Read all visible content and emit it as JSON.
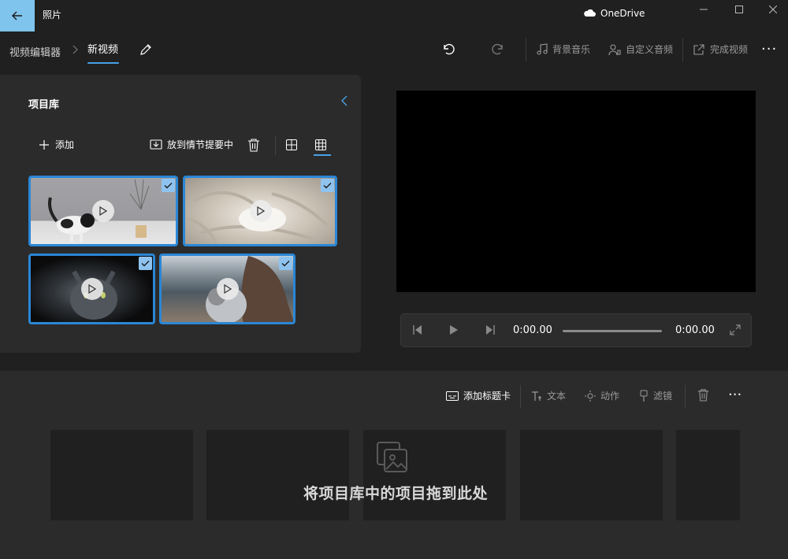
{
  "titlebar": {
    "app_title": "照片",
    "onedrive_label": "OneDrive",
    "back_icon": "arrow-left-icon",
    "accent": "#7fc4ec"
  },
  "toolbar": {
    "breadcrumb_root": "视频编辑器",
    "breadcrumb_current": "新视频",
    "background_music": "背景音乐",
    "custom_audio": "自定义音频",
    "finish_video": "完成视频",
    "more": "···"
  },
  "library": {
    "title": "项目库",
    "add_label": "添加",
    "storyboard_label": "放到情节提要中",
    "thumbnails": [
      {
        "name": "cat-on-table",
        "selected": true
      },
      {
        "name": "white-rabbit-in-blanket",
        "selected": true
      },
      {
        "name": "grey-cat-dark",
        "selected": true
      },
      {
        "name": "woman-holding-cat",
        "selected": true
      }
    ]
  },
  "player": {
    "time_current": "0:00.00",
    "time_total": "0:00.00"
  },
  "storyboard": {
    "add_title_card": "添加标题卡",
    "text": "文本",
    "motion": "动作",
    "filters": "滤镜",
    "more": "···",
    "drop_hint": "将项目库中的项目拖到此处"
  },
  "colors": {
    "background": "#202020",
    "panel": "#2b2b2b",
    "selection": "#2b87d6",
    "disabled_text": "#9a9a9a"
  }
}
